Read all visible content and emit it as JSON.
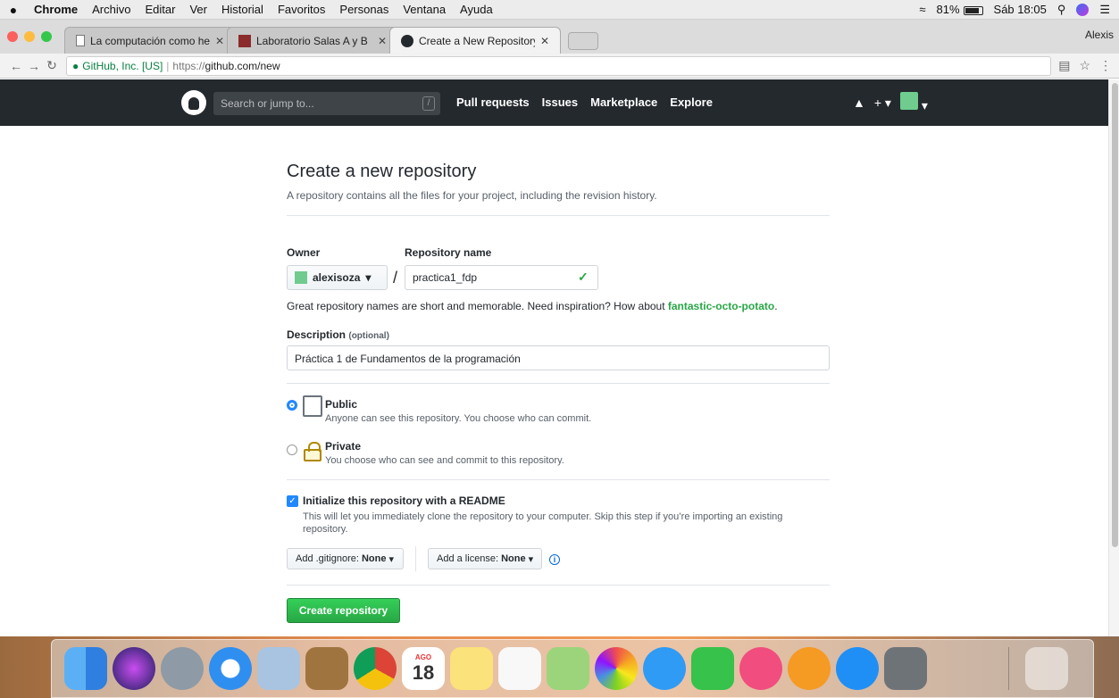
{
  "menubar": {
    "app": "Chrome",
    "items": [
      "Archivo",
      "Editar",
      "Ver",
      "Historial",
      "Favoritos",
      "Personas",
      "Ventana",
      "Ayuda"
    ],
    "battery": "81%",
    "clock": "Sáb 18:05"
  },
  "tabs": [
    {
      "title": "La computación como herrami"
    },
    {
      "title": "Laboratorio Salas A y B"
    },
    {
      "title": "Create a New Repository"
    }
  ],
  "profile_name": "Alexis",
  "omnibox": {
    "secure_label": "GitHub, Inc. [US]",
    "url_scheme": "https://",
    "url_host": "github.com",
    "url_path": "/new"
  },
  "github_header": {
    "search_placeholder": "Search or jump to...",
    "search_key": "/",
    "nav": [
      "Pull requests",
      "Issues",
      "Marketplace",
      "Explore"
    ]
  },
  "form": {
    "title": "Create a new repository",
    "subtitle": "A repository contains all the files for your project, including the revision history.",
    "owner_label": "Owner",
    "owner_value": "alexisoza",
    "repo_label": "Repository name",
    "repo_value": "practica1_fdp",
    "hint_prefix": "Great repository names are short and memorable. Need inspiration? How about ",
    "hint_suggestion": "fantastic-octo-potato",
    "hint_suffix": ".",
    "description_label": "Description",
    "description_optional": "(optional)",
    "description_value": "Práctica 1 de Fundamentos de la programación",
    "public_title": "Public",
    "public_desc": "Anyone can see this repository. You choose who can commit.",
    "private_title": "Private",
    "private_desc": "You choose who can see and commit to this repository.",
    "readme_title": "Initialize this repository with a README",
    "readme_desc": "This will let you immediately clone the repository to your computer. Skip this step if you’re importing an existing repository.",
    "gitignore_label": "Add .gitignore:",
    "gitignore_value": "None",
    "license_label": "Add a license:",
    "license_value": "None",
    "info_glyph": "i",
    "create_button": "Create repository"
  },
  "dock": {
    "calendar_month": "AGO",
    "calendar_day": "18",
    "apps": [
      "finder",
      "siri",
      "launchpad",
      "safari",
      "mail",
      "notebook",
      "chrome",
      "calendar",
      "notes",
      "reminders",
      "maps",
      "photos",
      "messages",
      "facetime",
      "itunes",
      "ibooks",
      "app-store",
      "system-preferences",
      "trash"
    ]
  }
}
